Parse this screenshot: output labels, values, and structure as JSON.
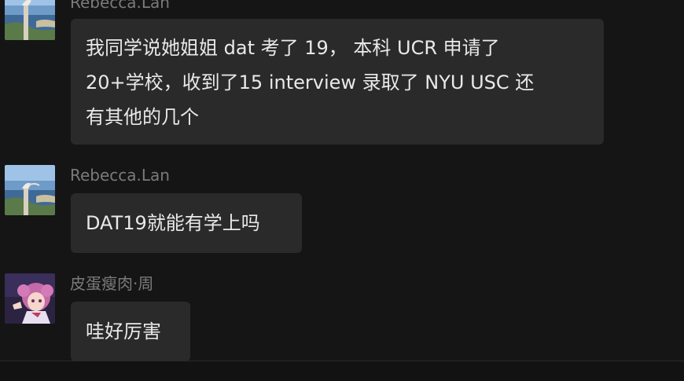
{
  "messages": [
    {
      "sender": "Rebecca.Lan",
      "avatar": "coastal-cliff-avatar",
      "lines": [
        "我同学说她姐姐 dat 考了 19， 本科 UCR 申请了",
        "20+学校，收到了15 interview 录取了 NYU USC 还",
        "有其他的几个"
      ]
    },
    {
      "sender": "Rebecca.Lan",
      "avatar": "coastal-cliff-avatar",
      "lines": [
        "DAT19就能有学上吗"
      ]
    },
    {
      "sender": "皮蛋瘦肉·周",
      "avatar": "anime-girl-avatar",
      "lines": [
        "哇好厉害"
      ]
    }
  ],
  "colors": {
    "background": "#151515",
    "bubble": "#2a2a2a",
    "sender_text": "#7a7a7a",
    "message_text": "#e9e9e9"
  }
}
